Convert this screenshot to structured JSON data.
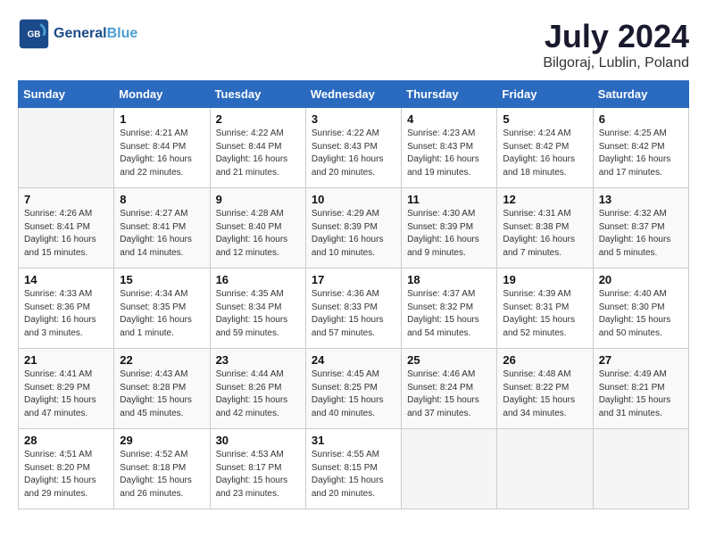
{
  "header": {
    "logo_line1": "General",
    "logo_line2": "Blue",
    "month_year": "July 2024",
    "location": "Bilgoraj, Lublin, Poland"
  },
  "days_of_week": [
    "Sunday",
    "Monday",
    "Tuesday",
    "Wednesday",
    "Thursday",
    "Friday",
    "Saturday"
  ],
  "weeks": [
    [
      {
        "day": "",
        "info": ""
      },
      {
        "day": "1",
        "info": "Sunrise: 4:21 AM\nSunset: 8:44 PM\nDaylight: 16 hours\nand 22 minutes."
      },
      {
        "day": "2",
        "info": "Sunrise: 4:22 AM\nSunset: 8:44 PM\nDaylight: 16 hours\nand 21 minutes."
      },
      {
        "day": "3",
        "info": "Sunrise: 4:22 AM\nSunset: 8:43 PM\nDaylight: 16 hours\nand 20 minutes."
      },
      {
        "day": "4",
        "info": "Sunrise: 4:23 AM\nSunset: 8:43 PM\nDaylight: 16 hours\nand 19 minutes."
      },
      {
        "day": "5",
        "info": "Sunrise: 4:24 AM\nSunset: 8:42 PM\nDaylight: 16 hours\nand 18 minutes."
      },
      {
        "day": "6",
        "info": "Sunrise: 4:25 AM\nSunset: 8:42 PM\nDaylight: 16 hours\nand 17 minutes."
      }
    ],
    [
      {
        "day": "7",
        "info": "Sunrise: 4:26 AM\nSunset: 8:41 PM\nDaylight: 16 hours\nand 15 minutes."
      },
      {
        "day": "8",
        "info": "Sunrise: 4:27 AM\nSunset: 8:41 PM\nDaylight: 16 hours\nand 14 minutes."
      },
      {
        "day": "9",
        "info": "Sunrise: 4:28 AM\nSunset: 8:40 PM\nDaylight: 16 hours\nand 12 minutes."
      },
      {
        "day": "10",
        "info": "Sunrise: 4:29 AM\nSunset: 8:39 PM\nDaylight: 16 hours\nand 10 minutes."
      },
      {
        "day": "11",
        "info": "Sunrise: 4:30 AM\nSunset: 8:39 PM\nDaylight: 16 hours\nand 9 minutes."
      },
      {
        "day": "12",
        "info": "Sunrise: 4:31 AM\nSunset: 8:38 PM\nDaylight: 16 hours\nand 7 minutes."
      },
      {
        "day": "13",
        "info": "Sunrise: 4:32 AM\nSunset: 8:37 PM\nDaylight: 16 hours\nand 5 minutes."
      }
    ],
    [
      {
        "day": "14",
        "info": "Sunrise: 4:33 AM\nSunset: 8:36 PM\nDaylight: 16 hours\nand 3 minutes."
      },
      {
        "day": "15",
        "info": "Sunrise: 4:34 AM\nSunset: 8:35 PM\nDaylight: 16 hours\nand 1 minute."
      },
      {
        "day": "16",
        "info": "Sunrise: 4:35 AM\nSunset: 8:34 PM\nDaylight: 15 hours\nand 59 minutes."
      },
      {
        "day": "17",
        "info": "Sunrise: 4:36 AM\nSunset: 8:33 PM\nDaylight: 15 hours\nand 57 minutes."
      },
      {
        "day": "18",
        "info": "Sunrise: 4:37 AM\nSunset: 8:32 PM\nDaylight: 15 hours\nand 54 minutes."
      },
      {
        "day": "19",
        "info": "Sunrise: 4:39 AM\nSunset: 8:31 PM\nDaylight: 15 hours\nand 52 minutes."
      },
      {
        "day": "20",
        "info": "Sunrise: 4:40 AM\nSunset: 8:30 PM\nDaylight: 15 hours\nand 50 minutes."
      }
    ],
    [
      {
        "day": "21",
        "info": "Sunrise: 4:41 AM\nSunset: 8:29 PM\nDaylight: 15 hours\nand 47 minutes."
      },
      {
        "day": "22",
        "info": "Sunrise: 4:43 AM\nSunset: 8:28 PM\nDaylight: 15 hours\nand 45 minutes."
      },
      {
        "day": "23",
        "info": "Sunrise: 4:44 AM\nSunset: 8:26 PM\nDaylight: 15 hours\nand 42 minutes."
      },
      {
        "day": "24",
        "info": "Sunrise: 4:45 AM\nSunset: 8:25 PM\nDaylight: 15 hours\nand 40 minutes."
      },
      {
        "day": "25",
        "info": "Sunrise: 4:46 AM\nSunset: 8:24 PM\nDaylight: 15 hours\nand 37 minutes."
      },
      {
        "day": "26",
        "info": "Sunrise: 4:48 AM\nSunset: 8:22 PM\nDaylight: 15 hours\nand 34 minutes."
      },
      {
        "day": "27",
        "info": "Sunrise: 4:49 AM\nSunset: 8:21 PM\nDaylight: 15 hours\nand 31 minutes."
      }
    ],
    [
      {
        "day": "28",
        "info": "Sunrise: 4:51 AM\nSunset: 8:20 PM\nDaylight: 15 hours\nand 29 minutes."
      },
      {
        "day": "29",
        "info": "Sunrise: 4:52 AM\nSunset: 8:18 PM\nDaylight: 15 hours\nand 26 minutes."
      },
      {
        "day": "30",
        "info": "Sunrise: 4:53 AM\nSunset: 8:17 PM\nDaylight: 15 hours\nand 23 minutes."
      },
      {
        "day": "31",
        "info": "Sunrise: 4:55 AM\nSunset: 8:15 PM\nDaylight: 15 hours\nand 20 minutes."
      },
      {
        "day": "",
        "info": ""
      },
      {
        "day": "",
        "info": ""
      },
      {
        "day": "",
        "info": ""
      }
    ]
  ]
}
